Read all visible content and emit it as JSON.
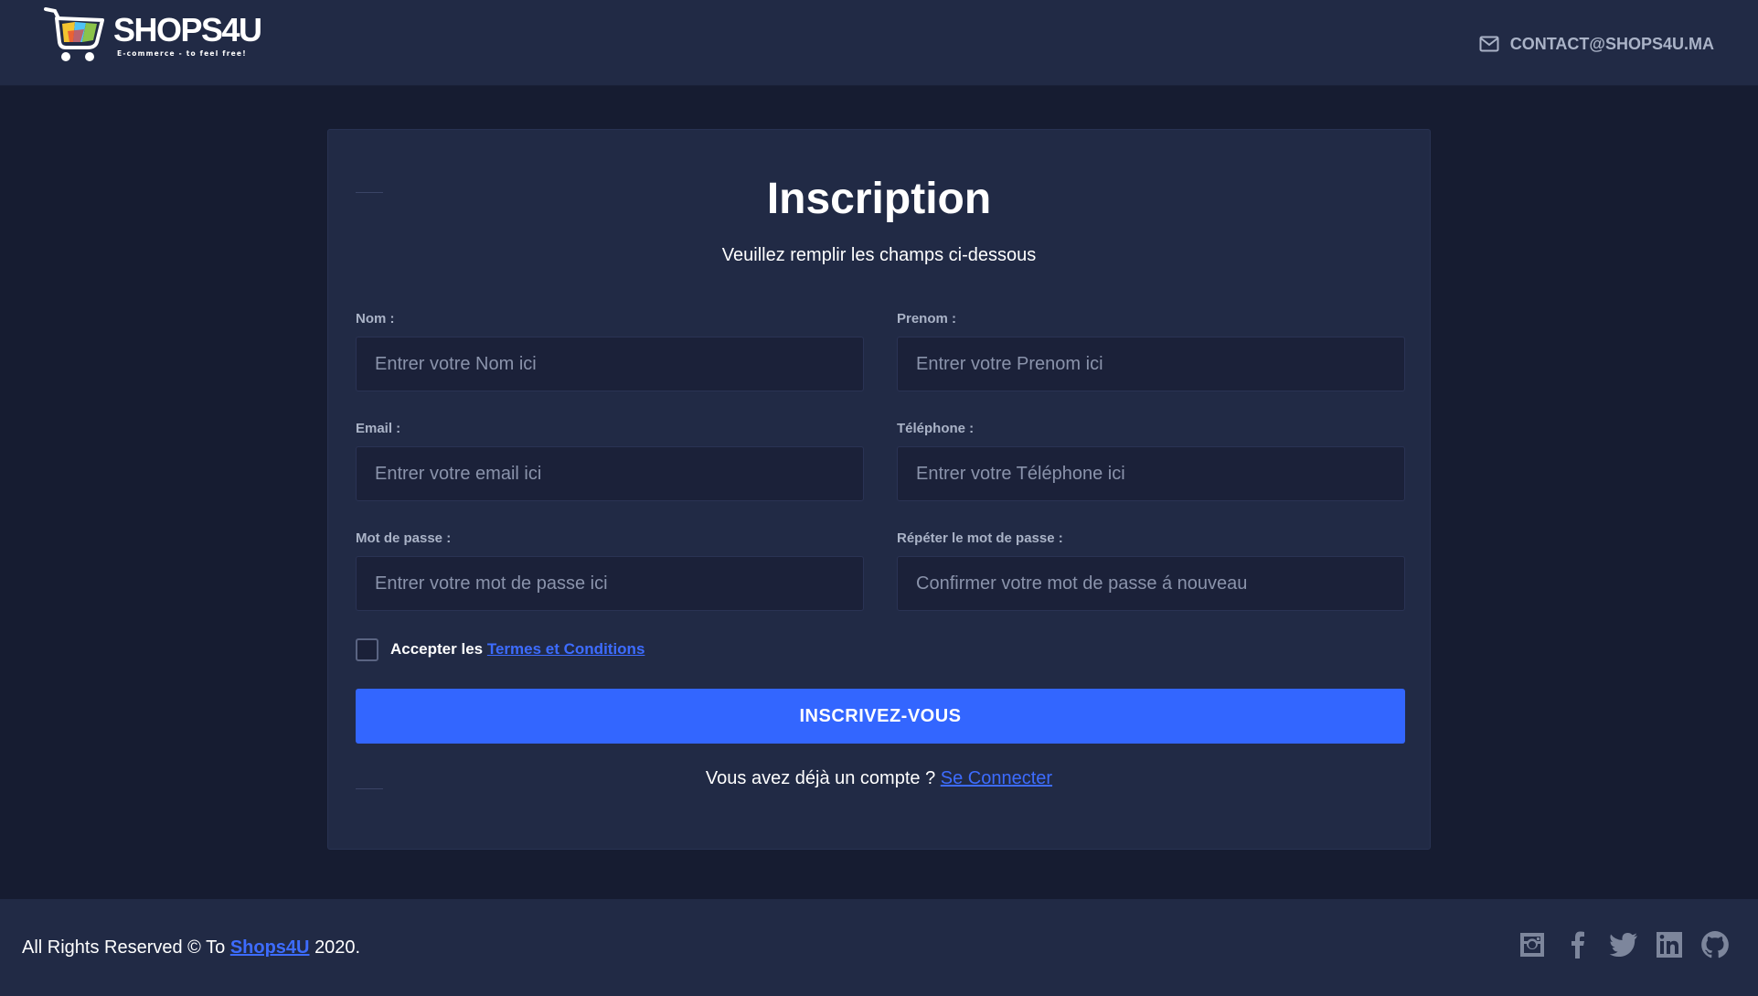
{
  "header": {
    "logo_title": "SHOPS4U",
    "logo_tagline": "E-commerce - to feel free!",
    "contact_email": "CONTACT@SHOPS4U.MA",
    "contact_icon": "envelope-icon"
  },
  "form": {
    "title": "Inscription",
    "subtitle": "Veuillez remplir les champs ci-dessous",
    "fields": [
      {
        "label": "Nom :",
        "placeholder": "Entrer votre Nom ici",
        "value": ""
      },
      {
        "label": "Prenom :",
        "placeholder": "Entrer votre Prenom ici",
        "value": ""
      },
      {
        "label": "Email :",
        "placeholder": "Entrer votre email ici",
        "value": ""
      },
      {
        "label": "Téléphone :",
        "placeholder": "Entrer votre Téléphone ici",
        "value": ""
      },
      {
        "label": "Mot de passe :",
        "placeholder": "Entrer votre mot de passe ici",
        "value": ""
      },
      {
        "label": "Répéter le mot de passe :",
        "placeholder": "Confirmer votre mot de passe á nouveau",
        "value": ""
      }
    ],
    "terms_prefix": "Accepter les",
    "terms_link": "Termes et Conditions",
    "terms_checked": false,
    "submit_label": "INSCRIVEZ-VOUS",
    "login_prompt": "Vous avez déjà un compte ?",
    "login_link": "Se Connecter"
  },
  "footer": {
    "copyright_prefix": "All Rights Reserved © To",
    "brand_link": "Shops4U",
    "copyright_suffix": "2020.",
    "socials": [
      "instagram-icon",
      "facebook-icon",
      "twitter-icon",
      "linkedin-icon",
      "github-icon"
    ]
  },
  "colors": {
    "page_bg": "#161c31",
    "panel_bg": "#212a45",
    "input_bg": "#1b2139",
    "accent": "#3366ff",
    "muted_text": "#aab3c7"
  }
}
